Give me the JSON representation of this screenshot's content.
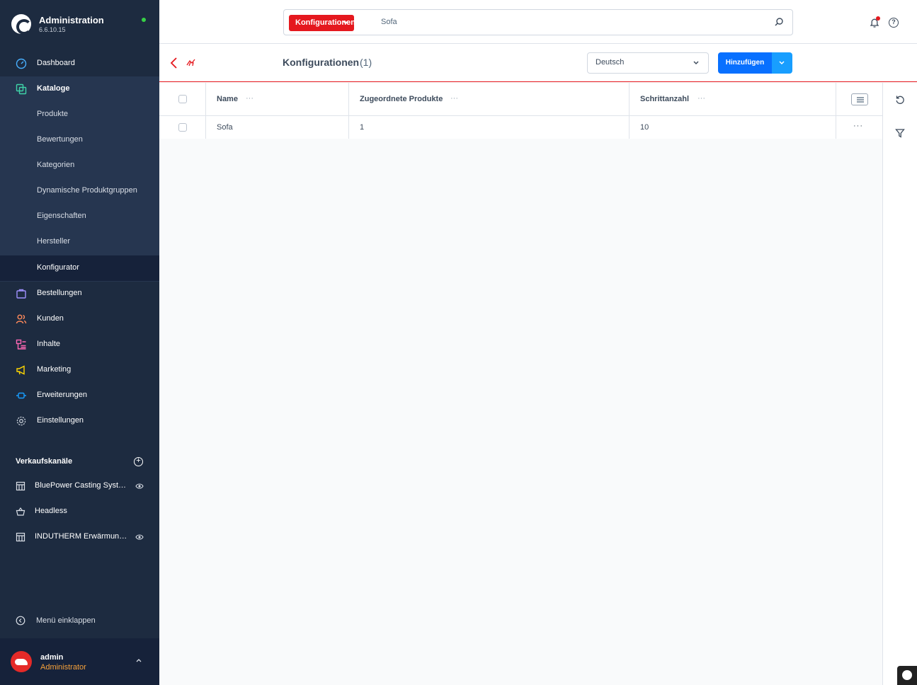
{
  "app": {
    "title": "Administration",
    "version": "6.6.10.15"
  },
  "nav": {
    "dashboard": "Dashboard",
    "catalogues": "Kataloge",
    "sub": [
      "Produkte",
      "Bewertungen",
      "Kategorien",
      "Dynamische Produktgruppen",
      "Eigenschaften",
      "Hersteller",
      "Konfigurator"
    ],
    "orders": "Bestellungen",
    "customers": "Kunden",
    "content": "Inhalte",
    "marketing": "Marketing",
    "extensions": "Erweiterungen",
    "settings": "Einstellungen"
  },
  "sales_channels": {
    "title": "Verkaufskanäle",
    "items": [
      "BluePower Casting Systeme",
      "Headless",
      "INDUTHERM Erwärmungsanlagen"
    ]
  },
  "collapse_label": "Menü einklappen",
  "user": {
    "name": "admin",
    "role": "Administrator"
  },
  "search": {
    "type": "Konfigurationen",
    "value": "Sofa"
  },
  "page": {
    "title": "Konfigurationen",
    "count": "(1)",
    "language": "Deutsch",
    "add_label": "Hinzufügen"
  },
  "table": {
    "columns": [
      "Name",
      "Zugeordnete Produkte",
      "Schrittanzahl"
    ],
    "rows": [
      {
        "name": "Sofa",
        "products": "1",
        "steps": "10"
      }
    ]
  },
  "colors": {
    "sidebar": "#1d2b40",
    "accent": "#e5181e",
    "primary": "#0870ff"
  }
}
